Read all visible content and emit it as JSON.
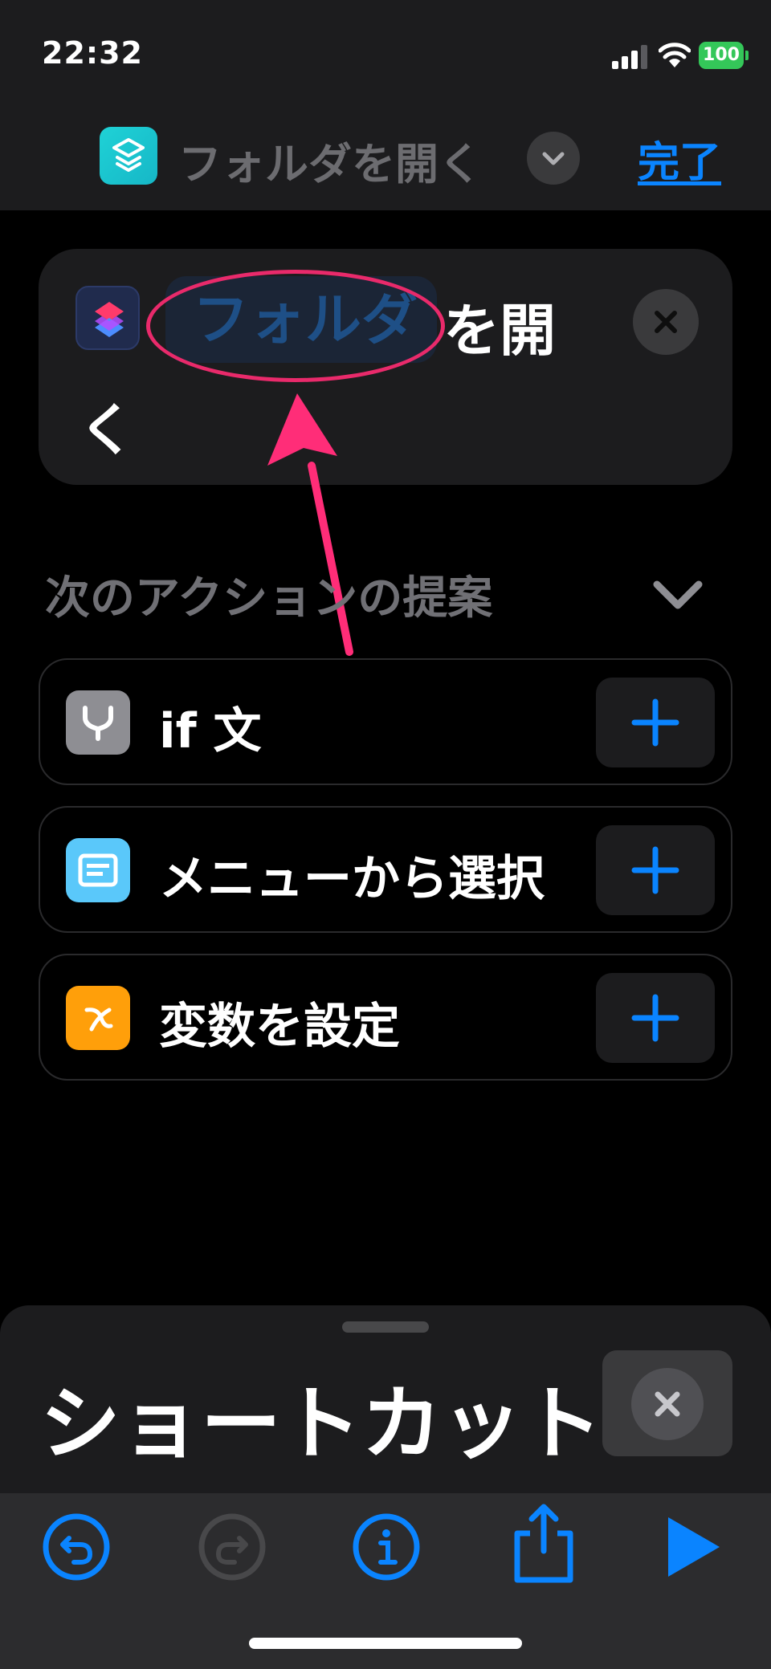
{
  "status_bar": {
    "time": "22:32",
    "battery": "100"
  },
  "nav": {
    "title": "フォルダを開く",
    "done_label": "完了"
  },
  "action_card": {
    "token_label": "フォルダ",
    "text_line1": "を開",
    "text_line2": "く"
  },
  "suggestions": {
    "title": "次のアクションの提案",
    "items": [
      {
        "label": "if 文",
        "icon": "branch-icon",
        "icon_color": "#8e8e93"
      },
      {
        "label": "メニューから選択",
        "icon": "menu-icon",
        "icon_color": "#5ac8fa"
      },
      {
        "label": "変数を設定",
        "icon": "variable-icon",
        "icon_color": "#ff9f0a"
      }
    ]
  },
  "sheet": {
    "title": "ショートカット"
  },
  "colors": {
    "accent": "#0a84ff",
    "highlight": "#e92a6b"
  }
}
